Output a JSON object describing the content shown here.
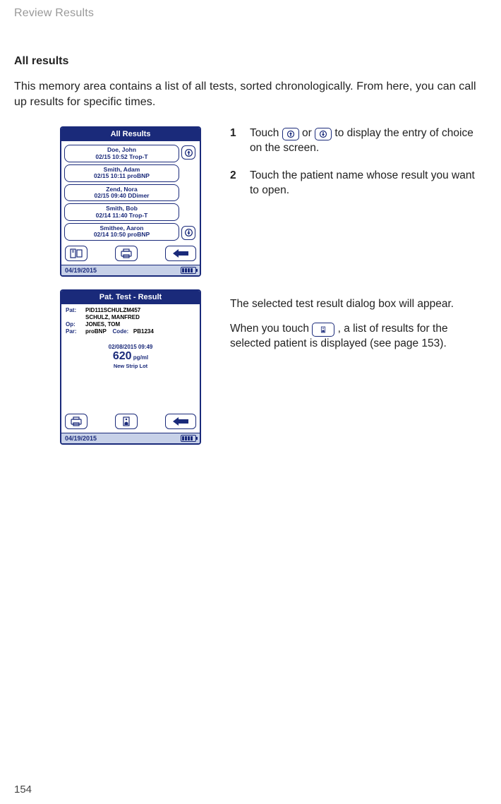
{
  "header_running": "Review Results",
  "section_title": "All results",
  "intro": "This memory area contains a list of all tests, sorted chronologically. From here, you can call up results for specific times.",
  "steps": [
    {
      "num": "1",
      "text_a": "Touch ",
      "text_b": " or ",
      "text_c": " to display the entry of choice on the screen."
    },
    {
      "num": "2",
      "text_a": "Touch the patient name whose result you want to open."
    }
  ],
  "para1": "The selected test result dialog box will appear.",
  "para2_a": "When you touch ",
  "para2_b": ", a list of results for the selected patient is displayed (see page 153).",
  "device1": {
    "title": "All Results",
    "items": [
      {
        "name": "Doe, John",
        "info": "02/15 10:52 Trop-T"
      },
      {
        "name": "Smith, Adam",
        "info": "02/15 10:11 proBNP"
      },
      {
        "name": "Zend, Nora",
        "info": "02/15 09:40 DDimer"
      },
      {
        "name": "Smith, Bob",
        "info": "02/14 11:40 Trop-T"
      },
      {
        "name": "Smithee, Aaron",
        "info": "02/14 10:50 proBNP"
      }
    ],
    "status_date": "04/19/2015"
  },
  "device2": {
    "title": "Pat. Test - Result",
    "pat_label": "Pat:",
    "pat_id": "PID111SCHULZM457",
    "pat_name": "SCHULZ, MANFRED",
    "op_label": "Op:",
    "op": "JONES, TOM",
    "par_label": "Par:",
    "par": "proBNP",
    "code_label": "Code:",
    "code": "PB1234",
    "timestamp": "02/08/2015  09:49",
    "value": "620",
    "unit": "pg/ml",
    "note": "New Strip Lot",
    "status_date": "04/19/2015"
  },
  "page_num": "154"
}
